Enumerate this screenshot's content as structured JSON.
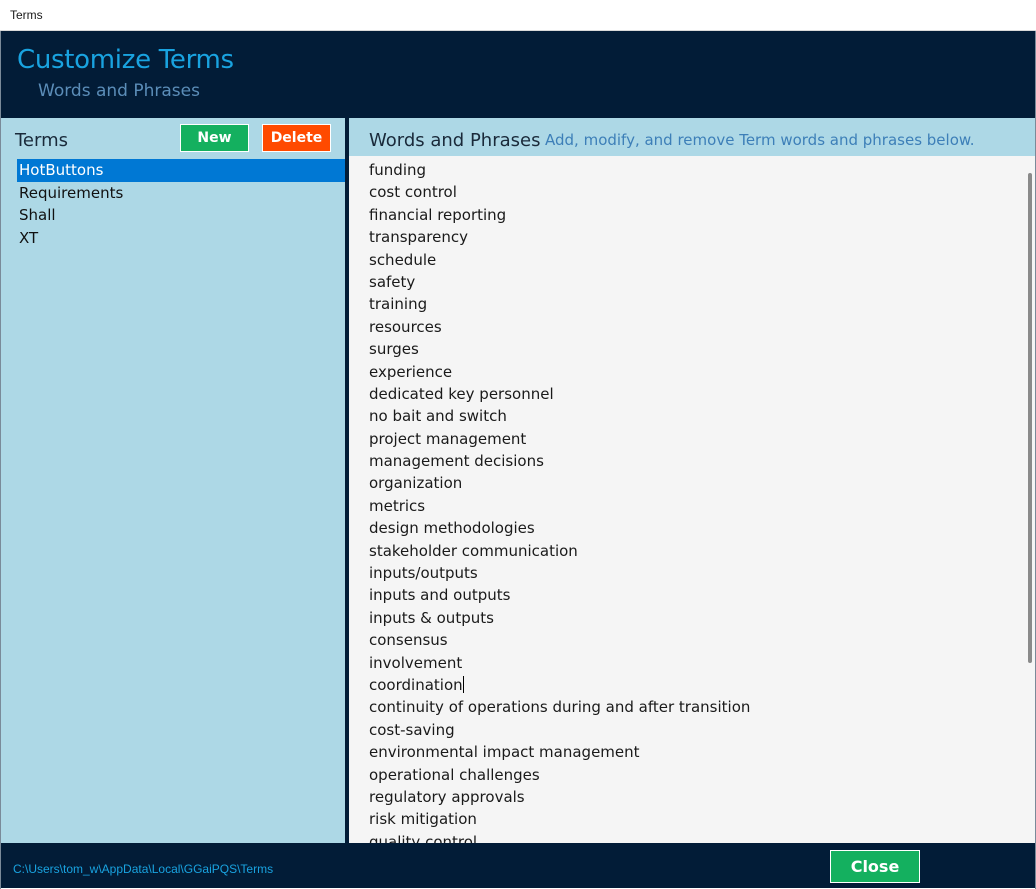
{
  "window": {
    "title": "Terms"
  },
  "header": {
    "title": "Customize Terms",
    "subtitle": "Words and Phrases"
  },
  "terms_panel": {
    "title": "Terms",
    "new_label": "New",
    "delete_label": "Delete",
    "items": [
      "HotButtons",
      "Requirements",
      "Shall",
      "XT"
    ],
    "selected": "HotButtons"
  },
  "words_panel": {
    "title": "Words and Phrases",
    "hint": "Add, modify, and remove Term words and phrases below.",
    "items": [
      "funding",
      "cost control",
      "financial reporting",
      "transparency",
      "schedule",
      "safety",
      "training",
      "resources",
      "surges",
      "experience",
      "dedicated key personnel",
      "no bait and switch",
      "project management",
      "management decisions",
      "organization",
      "metrics",
      "design methodologies",
      "stakeholder communication",
      "inputs/outputs",
      "inputs and outputs",
      "inputs & outputs",
      "consensus",
      "involvement",
      "coordination",
      "continuity of operations during and after transition",
      "cost-saving",
      "environmental impact management",
      "operational challenges",
      "regulatory approvals",
      "risk mitigation",
      "quality control"
    ]
  },
  "footer": {
    "path": "C:\\Users\\tom_w\\AppData\\Local\\GGaiPQS\\Terms",
    "close_label": "Close"
  },
  "colors": {
    "header_bg": "#021c37",
    "accent": "#19a3e0",
    "panel_bg": "#add8e6",
    "new_button": "#14b05f",
    "delete_button": "#ff4a00",
    "selection": "#0078d4"
  }
}
